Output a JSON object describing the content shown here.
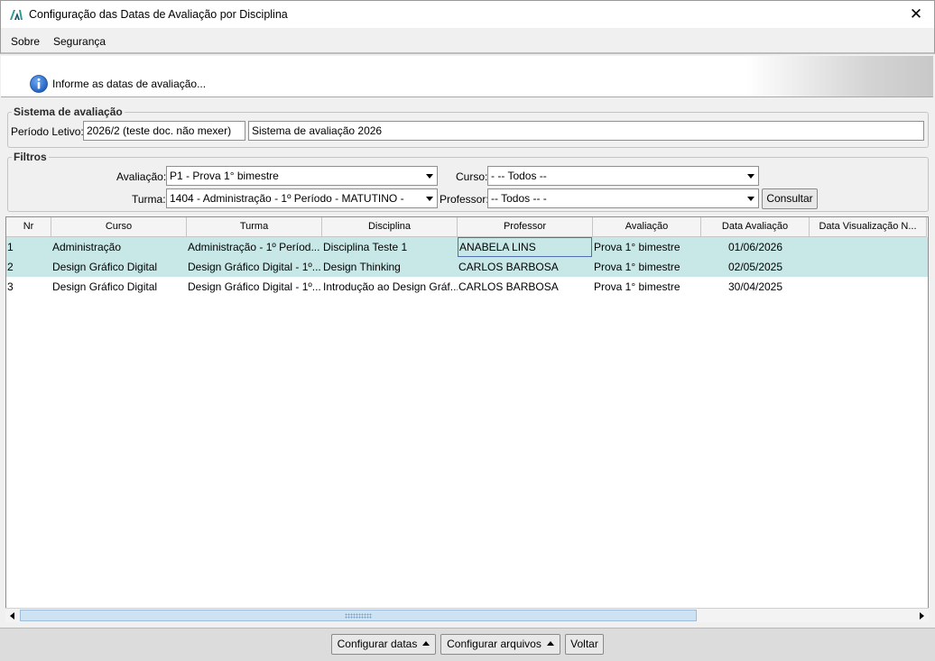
{
  "window": {
    "title": "Configuração das Datas de Avaliação por Disciplina",
    "close_glyph": "✕"
  },
  "menu": {
    "items": [
      "Sobre",
      "Segurança"
    ]
  },
  "banner": {
    "text": "Informe as datas de avaliação..."
  },
  "sistema": {
    "legend": "Sistema de avaliação",
    "periodo_label": "Período Letivo:",
    "periodo_value": "2026/2 (teste doc. não mexer)",
    "sistema_value": "Sistema de avaliação 2026"
  },
  "filtros": {
    "legend": "Filtros",
    "avaliacao_label": "Avaliação:",
    "avaliacao_value": "P1 - Prova 1° bimestre",
    "curso_label": "Curso:",
    "curso_value": "- -- Todos --",
    "turma_label": "Turma:",
    "turma_value": "1404 - Administração - 1º Período - MATUTINO -",
    "professor_label": "Professor:",
    "professor_value": "-- Todos -- -",
    "consultar_label": "Consultar"
  },
  "grid": {
    "columns": [
      "Nr",
      "Curso",
      "Turma",
      "Disciplina",
      "Professor",
      "Avaliação",
      "Data Avaliação",
      "Data Visualização N..."
    ],
    "rows": [
      [
        "1",
        "Administração",
        "Administração - 1º Períod...",
        "Disciplina Teste 1",
        "ANABELA LINS",
        "Prova 1° bimestre",
        "01/06/2026",
        ""
      ],
      [
        "2",
        "Design Gráfico Digital",
        "Design Gráfico Digital - 1º...",
        "Design Thinking",
        "CARLOS BARBOSA",
        "Prova 1° bimestre",
        "02/05/2025",
        ""
      ],
      [
        "3",
        "Design Gráfico Digital",
        "Design Gráfico Digital - 1º...",
        "Introdução ao Design Gráf...",
        "CARLOS BARBOSA",
        "Prova 1° bimestre",
        "30/04/2025",
        ""
      ]
    ],
    "selected_rows": [
      0,
      1
    ],
    "selected_color": "#c8e8e8"
  },
  "footer": {
    "configurar_datas": "Configurar datas",
    "configurar_arquivos": "Configurar arquivos",
    "voltar": "Voltar"
  },
  "icons": {
    "app": "app-logo-icon",
    "info": "info-icon",
    "close": "close-icon"
  },
  "colors": {
    "info_blue": "#1f5fbf",
    "app_logo": "#2a9d8f"
  }
}
